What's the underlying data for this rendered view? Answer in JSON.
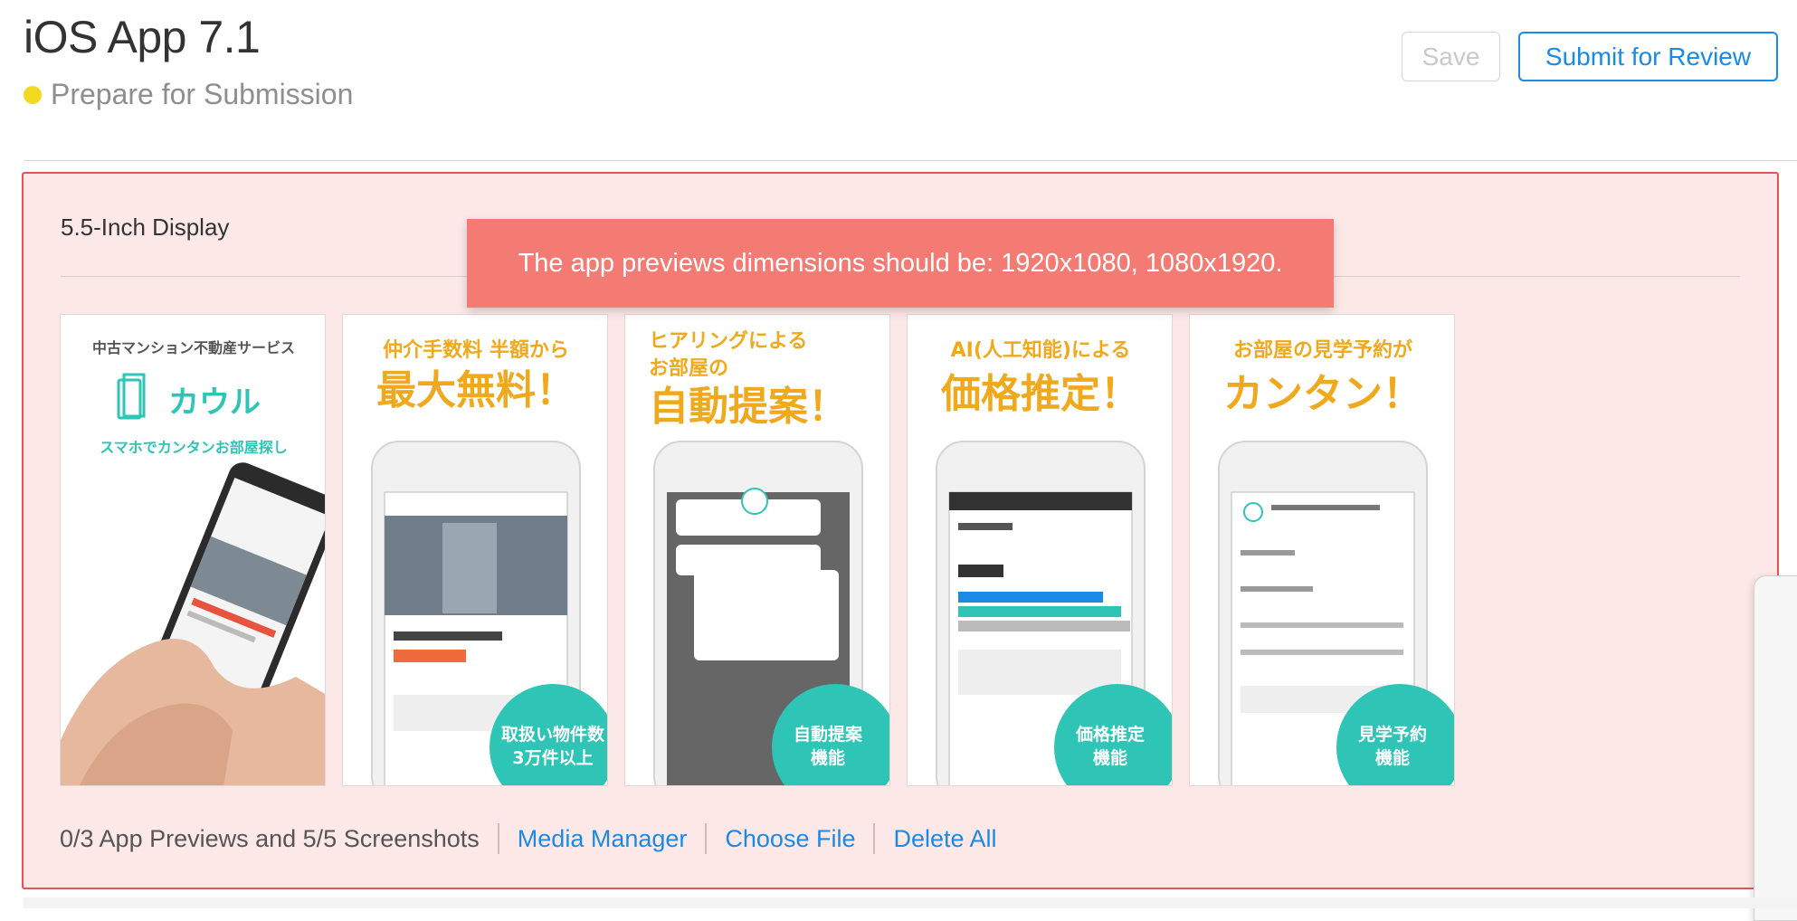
{
  "header": {
    "title": "iOS App 7.1",
    "status": "Prepare for Submission",
    "status_color": "#f2d91d",
    "save_label": "Save",
    "submit_label": "Submit for Review"
  },
  "panel": {
    "heading": "5.5-Inch Display",
    "error_message": "The app previews dimensions should be: 1920x1080, 1080x1920.",
    "border_color": "#e05656",
    "background": "#fde8e8"
  },
  "screenshots": [
    {
      "lines": [
        "中古マンション不動産サービス",
        "カウル",
        "スマホでカンタンお部屋探し"
      ]
    },
    {
      "lines": [
        "仲介手数料 半額から",
        "最大無料！"
      ],
      "badge": [
        "取扱い物件数",
        "3万件以上"
      ]
    },
    {
      "lines": [
        "ヒアリングによる",
        "お部屋の",
        "自動提案！"
      ],
      "badge": [
        "自動提案",
        "機能"
      ]
    },
    {
      "lines": [
        "AI(人工知能)による",
        "価格推定！"
      ],
      "badge": [
        "価格推定",
        "機能"
      ]
    },
    {
      "lines": [
        "お部屋の見学予約が",
        "カンタン！"
      ],
      "badge": [
        "見学予約",
        "機能"
      ]
    }
  ],
  "footer": {
    "count_text": "0/3 App Previews and 5/5 Screenshots",
    "media_manager": "Media Manager",
    "choose_file": "Choose File",
    "delete_all": "Delete All"
  }
}
